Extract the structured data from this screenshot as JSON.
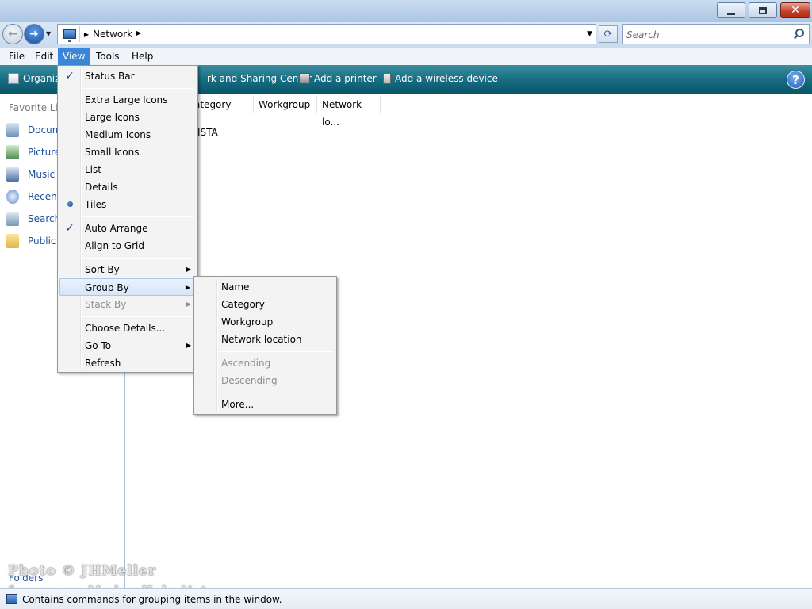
{
  "window": {
    "minimize_icon": "minimize-icon",
    "maximize_icon": "restore-icon",
    "close_icon": "close-icon",
    "close_glyph": "✕"
  },
  "address_bar": {
    "back_icon": "back-arrow-icon",
    "forward_icon": "forward-arrow-icon",
    "forward_glyph": "➜",
    "back_glyph": "←",
    "path": "Network",
    "refresh_glyph": "⟳"
  },
  "search": {
    "placeholder": "Search"
  },
  "menubar": [
    "File",
    "Edit",
    "View",
    "Tools",
    "Help"
  ],
  "toolbar": {
    "organize": "Organiz",
    "network_sharing": "rk and Sharing Center",
    "add_printer": "Add a printer",
    "add_wireless": "Add a wireless device",
    "help_glyph": "?"
  },
  "nav_pane": {
    "title": "Favorite Lin",
    "items": [
      {
        "label": "Docum",
        "icon": "documents-icon"
      },
      {
        "label": "Picture",
        "icon": "pictures-icon"
      },
      {
        "label": "Music",
        "icon": "music-icon"
      },
      {
        "label": "Recent",
        "icon": "recent-icon"
      },
      {
        "label": "Search",
        "icon": "search-folder-icon"
      },
      {
        "label": "Public",
        "icon": "public-folder-icon"
      }
    ],
    "folders_label": "Folders",
    "folders_chevron": "⌃"
  },
  "columns": [
    "ategory",
    "Workgroup",
    "Network lo..."
  ],
  "content_item": "ISTA",
  "view_menu": {
    "status_bar": "Status Bar",
    "extra_large_icons": "Extra Large Icons",
    "large_icons": "Large Icons",
    "medium_icons": "Medium Icons",
    "small_icons": "Small Icons",
    "list": "List",
    "details": "Details",
    "tiles": "Tiles",
    "auto_arrange": "Auto Arrange",
    "align_to_grid": "Align to Grid",
    "sort_by": "Sort By",
    "group_by": "Group By",
    "stack_by": "Stack By",
    "choose_details": "Choose Details...",
    "go_to": "Go To",
    "refresh": "Refresh",
    "check_glyph": "✓"
  },
  "group_by_menu": {
    "name": "Name",
    "category": "Category",
    "workgroup": "Workgroup",
    "network_location": "Network location",
    "ascending": "Ascending",
    "descending": "Descending",
    "more": "More..."
  },
  "status_bar": {
    "text": "Contains commands for grouping items in the window."
  },
  "watermark": {
    "line1": "Photo © JHMeller",
    "line2": "for use on ModemHelp.Net"
  }
}
